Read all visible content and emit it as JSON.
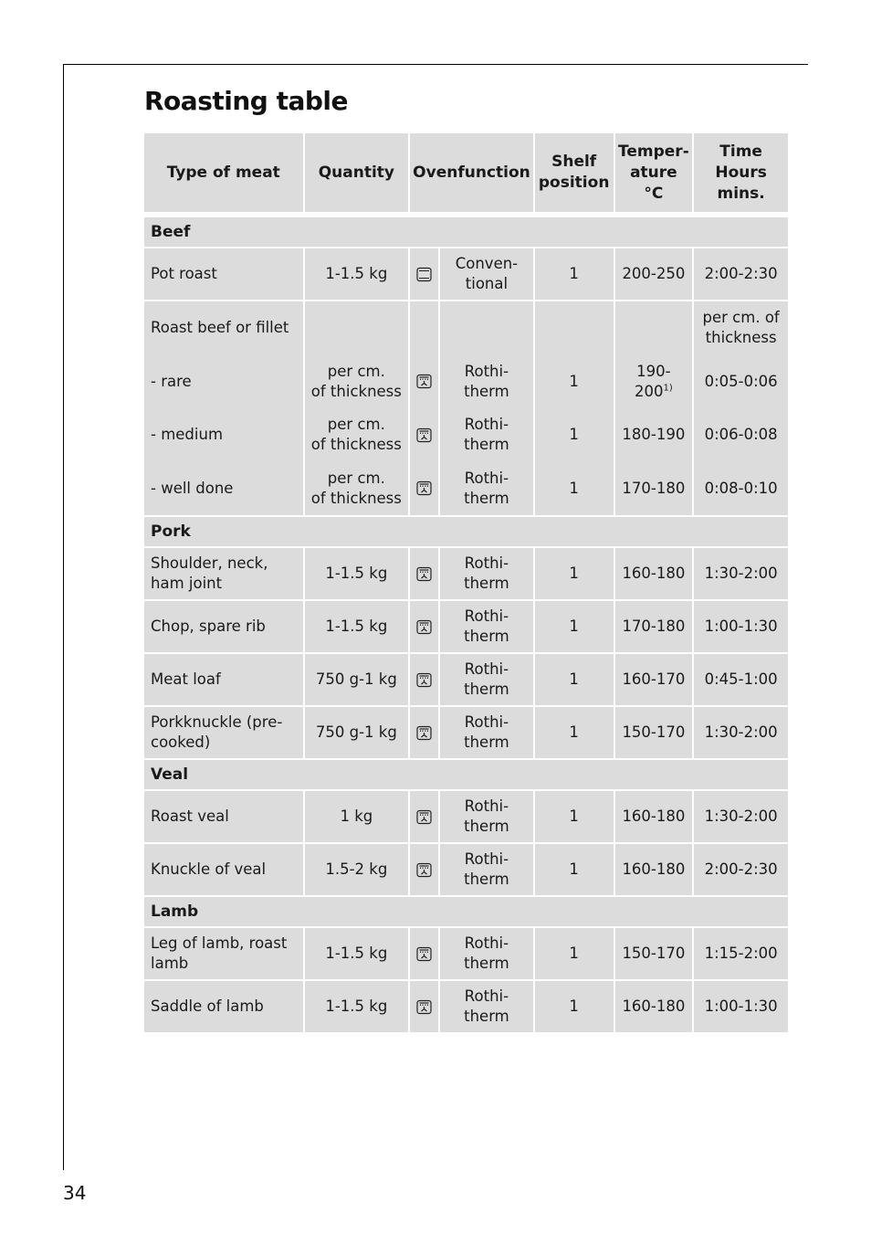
{
  "page": {
    "title": "Roasting table",
    "page_number": "34"
  },
  "table": {
    "headers": {
      "type_of_meat": "Type of meat",
      "quantity": "Quantity",
      "ovenfunction": "Ovenfunction",
      "shelf_position": "Shelf position",
      "temperature": "Temper- ature °C",
      "time": "Time Hours mins."
    },
    "header_lines": {
      "shelf": [
        "Shelf",
        "position"
      ],
      "temperature": [
        "Temper-",
        "ature",
        "°C"
      ],
      "time": [
        "Time",
        "Hours",
        "mins."
      ]
    },
    "sections": [
      {
        "name": "Beef",
        "rows": [
          {
            "type": "Pot roast",
            "quantity": "1-1.5 kg",
            "icon": "conventional-oven-icon",
            "function": [
              "Conven-",
              "tional"
            ],
            "shelf": "1",
            "temperature": "200-250",
            "time": "2:00-2:30"
          }
        ],
        "group": {
          "title": "Roast beef or fillet",
          "time_note": [
            "per cm. of",
            "thickness"
          ],
          "rows": [
            {
              "type": "- rare",
              "quantity": [
                "per cm.",
                "of thickness"
              ],
              "icon": "rotitherm-icon",
              "function": [
                "Rothi-",
                "therm"
              ],
              "shelf": "1",
              "temperature": [
                "190-",
                "200"
              ],
              "temperature_footnote": "1)",
              "time": "0:05-0:06"
            },
            {
              "type": "- medium",
              "quantity": [
                "per cm.",
                "of thickness"
              ],
              "icon": "rotitherm-icon",
              "function": [
                "Rothi-",
                "therm"
              ],
              "shelf": "1",
              "temperature": "180-190",
              "time": "0:06-0:08"
            },
            {
              "type": "- well done",
              "quantity": [
                "per cm.",
                "of thickness"
              ],
              "icon": "rotitherm-icon",
              "function": [
                "Rothi-",
                "therm"
              ],
              "shelf": "1",
              "temperature": "170-180",
              "time": "0:08-0:10"
            }
          ]
        }
      },
      {
        "name": "Pork",
        "rows": [
          {
            "type": "Shoulder, neck, ham joint",
            "quantity": "1-1.5 kg",
            "icon": "rotitherm-icon",
            "function": [
              "Rothi-",
              "therm"
            ],
            "shelf": "1",
            "temperature": "160-180",
            "time": "1:30-2:00"
          },
          {
            "type": "Chop, spare rib",
            "quantity": "1-1.5 kg",
            "icon": "rotitherm-icon",
            "function": [
              "Rothi-",
              "therm"
            ],
            "shelf": "1",
            "temperature": "170-180",
            "time": "1:00-1:30"
          },
          {
            "type": "Meat loaf",
            "quantity": "750 g-1 kg",
            "icon": "rotitherm-icon",
            "function": [
              "Rothi-",
              "therm"
            ],
            "shelf": "1",
            "temperature": "160-170",
            "time": "0:45-1:00"
          },
          {
            "type": "Porkknuckle (pre-cooked)",
            "quantity": "750 g-1 kg",
            "icon": "rotitherm-icon",
            "function": [
              "Rothi-",
              "therm"
            ],
            "shelf": "1",
            "temperature": "150-170",
            "time": "1:30-2:00"
          }
        ]
      },
      {
        "name": "Veal",
        "rows": [
          {
            "type": "Roast veal",
            "quantity": "1 kg",
            "icon": "rotitherm-icon",
            "function": [
              "Rothi-",
              "therm"
            ],
            "shelf": "1",
            "temperature": "160-180",
            "time": "1:30-2:00"
          },
          {
            "type": "Knuckle of veal",
            "quantity": "1.5-2 kg",
            "icon": "rotitherm-icon",
            "function": [
              "Rothi-",
              "therm"
            ],
            "shelf": "1",
            "temperature": "160-180",
            "time": "2:00-2:30"
          }
        ]
      },
      {
        "name": "Lamb",
        "rows": [
          {
            "type": "Leg of lamb, roast lamb",
            "quantity": "1-1.5 kg",
            "icon": "rotitherm-icon",
            "function": [
              "Rothi-",
              "therm"
            ],
            "shelf": "1",
            "temperature": "150-170",
            "time": "1:15-2:00"
          },
          {
            "type": "Saddle of lamb",
            "quantity": "1-1.5 kg",
            "icon": "rotitherm-icon",
            "function": [
              "Rothi-",
              "therm"
            ],
            "shelf": "1",
            "temperature": "160-180",
            "time": "1:00-1:30"
          }
        ]
      }
    ]
  },
  "colors": {
    "cell_background": "#dcdcdc",
    "text": "#1a1a1a",
    "rule": "#000000"
  }
}
